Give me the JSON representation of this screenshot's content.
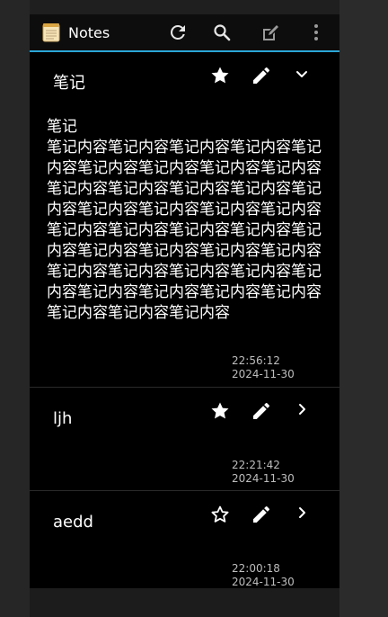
{
  "app": {
    "title": "Notes"
  },
  "toolbar": {
    "icons": [
      "notes-app-icon",
      "refresh-icon",
      "search-icon",
      "new-note-icon",
      "more-vert-icon"
    ]
  },
  "notes": [
    {
      "title": "笔记",
      "favorite": true,
      "expanded": true,
      "body": "笔记\n笔记内容笔记内容笔记内容笔记内容笔记内容笔记内容笔记内容笔记内容笔记内容笔记内容笔记内容笔记内容笔记内容笔记内容笔记内容笔记内容笔记内容笔记内容笔记内容笔记内容笔记内容笔记内容笔记内容笔记内容笔记内容笔记内容笔记内容笔记内容笔记内容笔记内容笔记内容笔记内容笔记内容笔记内容笔记内容笔记内容笔记内容笔记内容笔记内容",
      "time": "22:56:12",
      "date": "2024-11-30"
    },
    {
      "title": "ljh",
      "favorite": true,
      "expanded": false,
      "time": "22:21:42",
      "date": "2024-11-30"
    },
    {
      "title": "aedd",
      "favorite": false,
      "expanded": false,
      "time": "22:00:18",
      "date": "2024-11-30"
    }
  ]
}
